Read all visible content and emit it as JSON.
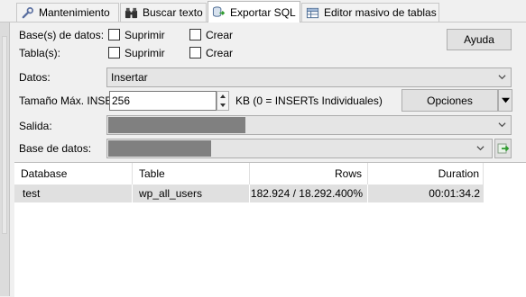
{
  "tabs": [
    {
      "label": "Mantenimiento",
      "icon": "wrench-icon"
    },
    {
      "label": "Buscar texto",
      "icon": "binoculars-icon"
    },
    {
      "label": "Exportar SQL",
      "icon": "export-sql-icon",
      "active": true
    },
    {
      "label": "Editor masivo de tablas",
      "icon": "table-editor-icon"
    }
  ],
  "form": {
    "databases_label": "Base(s) de datos:",
    "tables_label": "Tabla(s):",
    "suprimir_label": "Suprimir",
    "crear_label": "Crear",
    "help_button": "Ayuda",
    "datos_label": "Datos:",
    "datos_value": "Insertar",
    "tamano_label": "Tamaño Máx. INSE",
    "tamano_value": "256",
    "tamano_hint": "KB (0 = INSERTs Individuales)",
    "options_button": "Opciones",
    "salida_label": "Salida:",
    "base_datos_label": "Base de datos:"
  },
  "table": {
    "columns": [
      "Database",
      "Table",
      "Rows",
      "Duration"
    ],
    "rows": [
      {
        "database": "test",
        "table": "wp_all_users",
        "rows": "182.924 / 18.292.400%",
        "duration": "00:01:34.2"
      }
    ]
  },
  "colors": {
    "redaction": "#808080",
    "selected_row": "#e0e0e0",
    "accent_green": "#2e9b2e"
  }
}
